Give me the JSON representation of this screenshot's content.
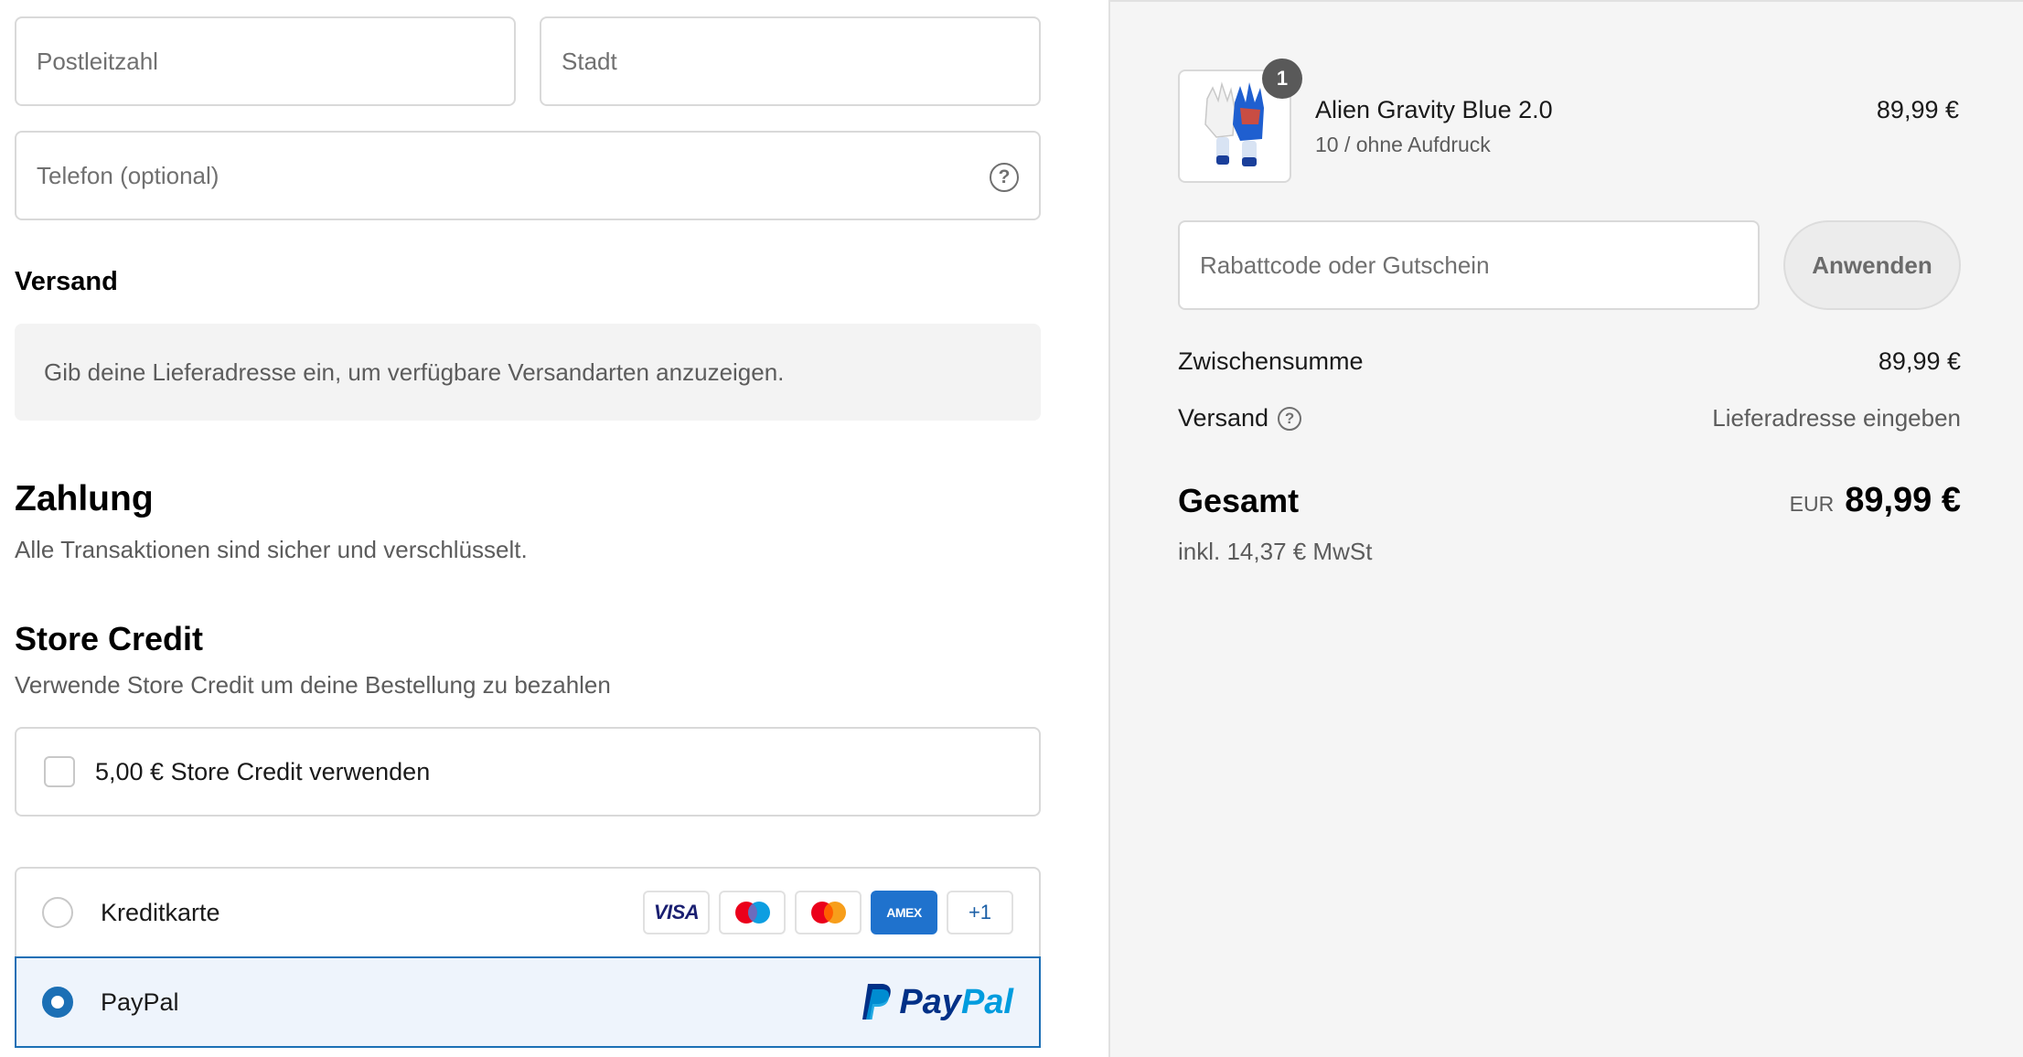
{
  "address": {
    "postal_code_placeholder": "Postleitzahl",
    "city_placeholder": "Stadt",
    "phone_placeholder": "Telefon (optional)"
  },
  "shipping": {
    "title": "Versand",
    "notice": "Gib deine Lieferadresse ein, um verfügbare Versandarten anzuzeigen."
  },
  "payment": {
    "title": "Zahlung",
    "subtitle": "Alle Transaktionen sind sicher und verschlüsselt.",
    "methods": [
      {
        "label": "Kreditkarte",
        "selected": false,
        "logos": [
          "VISA",
          "Maestro",
          "Mastercard",
          "AMEX",
          "+1"
        ]
      },
      {
        "label": "PayPal",
        "selected": true,
        "logo": "PayPal"
      }
    ]
  },
  "store_credit": {
    "title": "Store Credit",
    "subtitle": "Verwende Store Credit um deine Bestellung zu bezahlen",
    "checkbox_label": "5,00 € Store Credit verwenden",
    "checked": false
  },
  "summary": {
    "product": {
      "name": "Alien Gravity Blue 2.0",
      "variant": "10 / ohne Aufdruck",
      "price": "89,99 €",
      "quantity": "1",
      "image_icon": "goalkeeper-glove-image"
    },
    "discount_placeholder": "Rabattcode oder Gutschein",
    "apply_label": "Anwenden",
    "subtotal_label": "Zwischensumme",
    "subtotal_value": "89,99 €",
    "shipping_label": "Versand",
    "shipping_value": "Lieferadresse eingeben",
    "total_label": "Gesamt",
    "currency": "EUR",
    "total_value": "89,99 €",
    "tax_note": "inkl. 14,37 € MwSt"
  },
  "colors": {
    "accent": "#1b6fb5",
    "right_panel_bg": "#f5f5f5",
    "paypal_dark": "#003087",
    "paypal_light": "#009cde"
  }
}
